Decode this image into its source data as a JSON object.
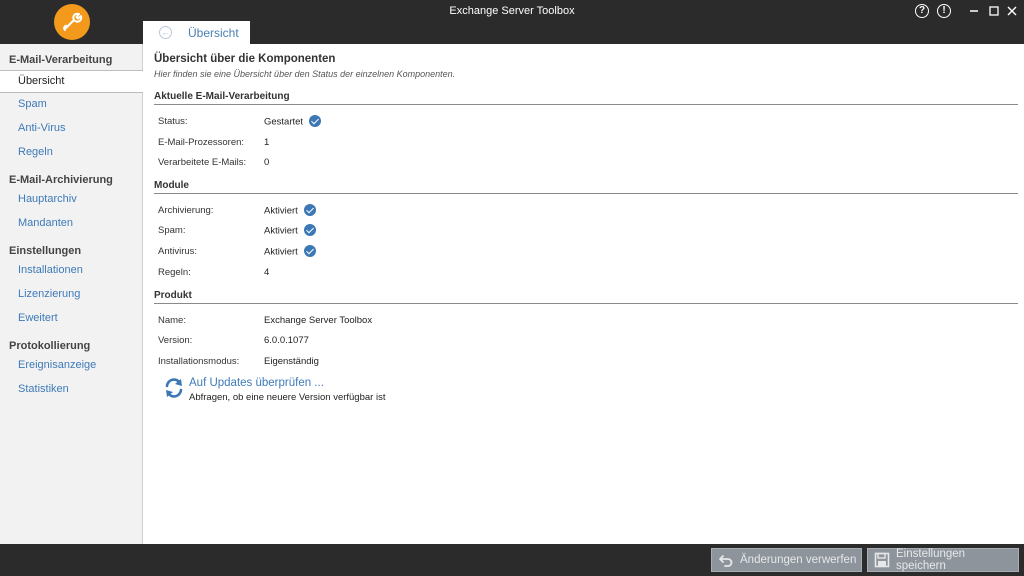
{
  "window": {
    "title": "Exchange Server Toolbox"
  },
  "tab": {
    "label": "Übersicht"
  },
  "sidebar": {
    "groups": [
      {
        "heading": "E-Mail-Verarbeitung",
        "items": [
          "Übersicht",
          "Spam",
          "Anti-Virus",
          "Regeln"
        ]
      },
      {
        "heading": "E-Mail-Archivierung",
        "items": [
          "Hauptarchiv",
          "Mandanten"
        ]
      },
      {
        "heading": "Einstellungen",
        "items": [
          "Installationen",
          "Lizenzierung",
          "Eweitert"
        ]
      },
      {
        "heading": "Protokollierung",
        "items": [
          "Ereignisanzeige",
          "Statistiken"
        ]
      }
    ],
    "active_item": "Übersicht"
  },
  "main": {
    "title": "Übersicht über die Komponenten",
    "subtitle": "Hier finden sie eine Übersicht über den Status der einzelnen Komponenten.",
    "sections": [
      {
        "heading": "Aktuelle E-Mail-Verarbeitung",
        "rows": [
          {
            "label": "Status:",
            "value": "Gestartet",
            "check": true
          },
          {
            "label": "E-Mail-Prozessoren:",
            "value": "1",
            "check": false
          },
          {
            "label": "Verarbeitete E-Mails:",
            "value": "0",
            "check": false
          }
        ]
      },
      {
        "heading": "Module",
        "rows": [
          {
            "label": "Archivierung:",
            "value": "Aktiviert",
            "check": true
          },
          {
            "label": "Spam:",
            "value": "Aktiviert",
            "check": true
          },
          {
            "label": "Antivirus:",
            "value": "Aktiviert",
            "check": true
          },
          {
            "label": "Regeln:",
            "value": "4",
            "check": false
          }
        ]
      },
      {
        "heading": "Produkt",
        "rows": [
          {
            "label": "Name:",
            "value": "Exchange Server Toolbox",
            "check": false
          },
          {
            "label": "Version:",
            "value": "6.0.0.1077",
            "check": false
          },
          {
            "label": "Installationsmodus:",
            "value": "Eigenständig",
            "check": false
          }
        ]
      }
    ],
    "update": {
      "link": "Auf Updates überprüfen ...",
      "description": "Abfragen, ob eine neuere Version verfügbar ist"
    }
  },
  "footer": {
    "discard_label": "Änderungen verwerfen",
    "save_label": "Einstellungen speichern"
  },
  "colors": {
    "accent": "#3d7ab8",
    "logo": "#f39a1c",
    "chrome": "#2b2b2b",
    "footer_button": "#8d949b"
  },
  "icons": {
    "logo": "wrench-logo-icon",
    "help": "help-icon",
    "info": "info-icon",
    "minimize": "minimize-icon",
    "maximize": "maximize-icon",
    "close": "close-icon",
    "back": "back-arrow-icon",
    "check": "check-circle-icon",
    "update": "refresh-icon",
    "discard": "undo-icon",
    "save": "save-icon"
  }
}
